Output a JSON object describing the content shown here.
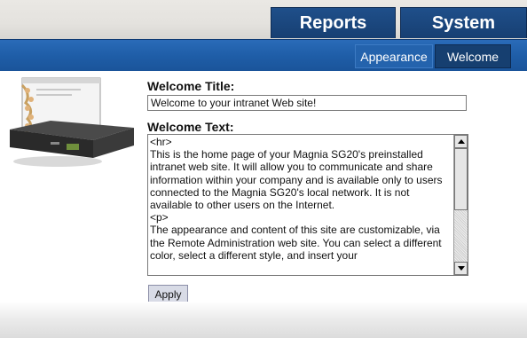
{
  "nav": {
    "main_tabs": [
      {
        "label": "Reports"
      },
      {
        "label": "System"
      }
    ],
    "sub_tabs": [
      {
        "label": "Appearance"
      },
      {
        "label": "Welcome",
        "selected": true
      }
    ]
  },
  "form": {
    "title_label": "Welcome Title:",
    "title_value": "Welcome to your intranet Web site!",
    "text_label": "Welcome Text:",
    "text_value": "<hr>\nThis is the home page of your Magnia SG20's preinstalled intranet web site.  It will allow you to communicate and share information within your company and is available only to users connected to the Magnia SG20's local network.  It is not available to other users on the Internet.\n<p>\nThe appearance and content of this site are customizable, via the Remote Administration web site.  You can select a different color, select a different style, and insert your",
    "apply_label": "Apply"
  },
  "icons": {
    "scroll_up": "scroll-up-arrow-icon",
    "scroll_down": "scroll-down-arrow-icon",
    "device": "server-appliance-icon"
  },
  "colors": {
    "main_tab_bg": "#173f72",
    "subnav_bg": "#1f5ea8",
    "selected_subtab_bg": "#163f70",
    "apply_bg": "#d8dbe6"
  }
}
